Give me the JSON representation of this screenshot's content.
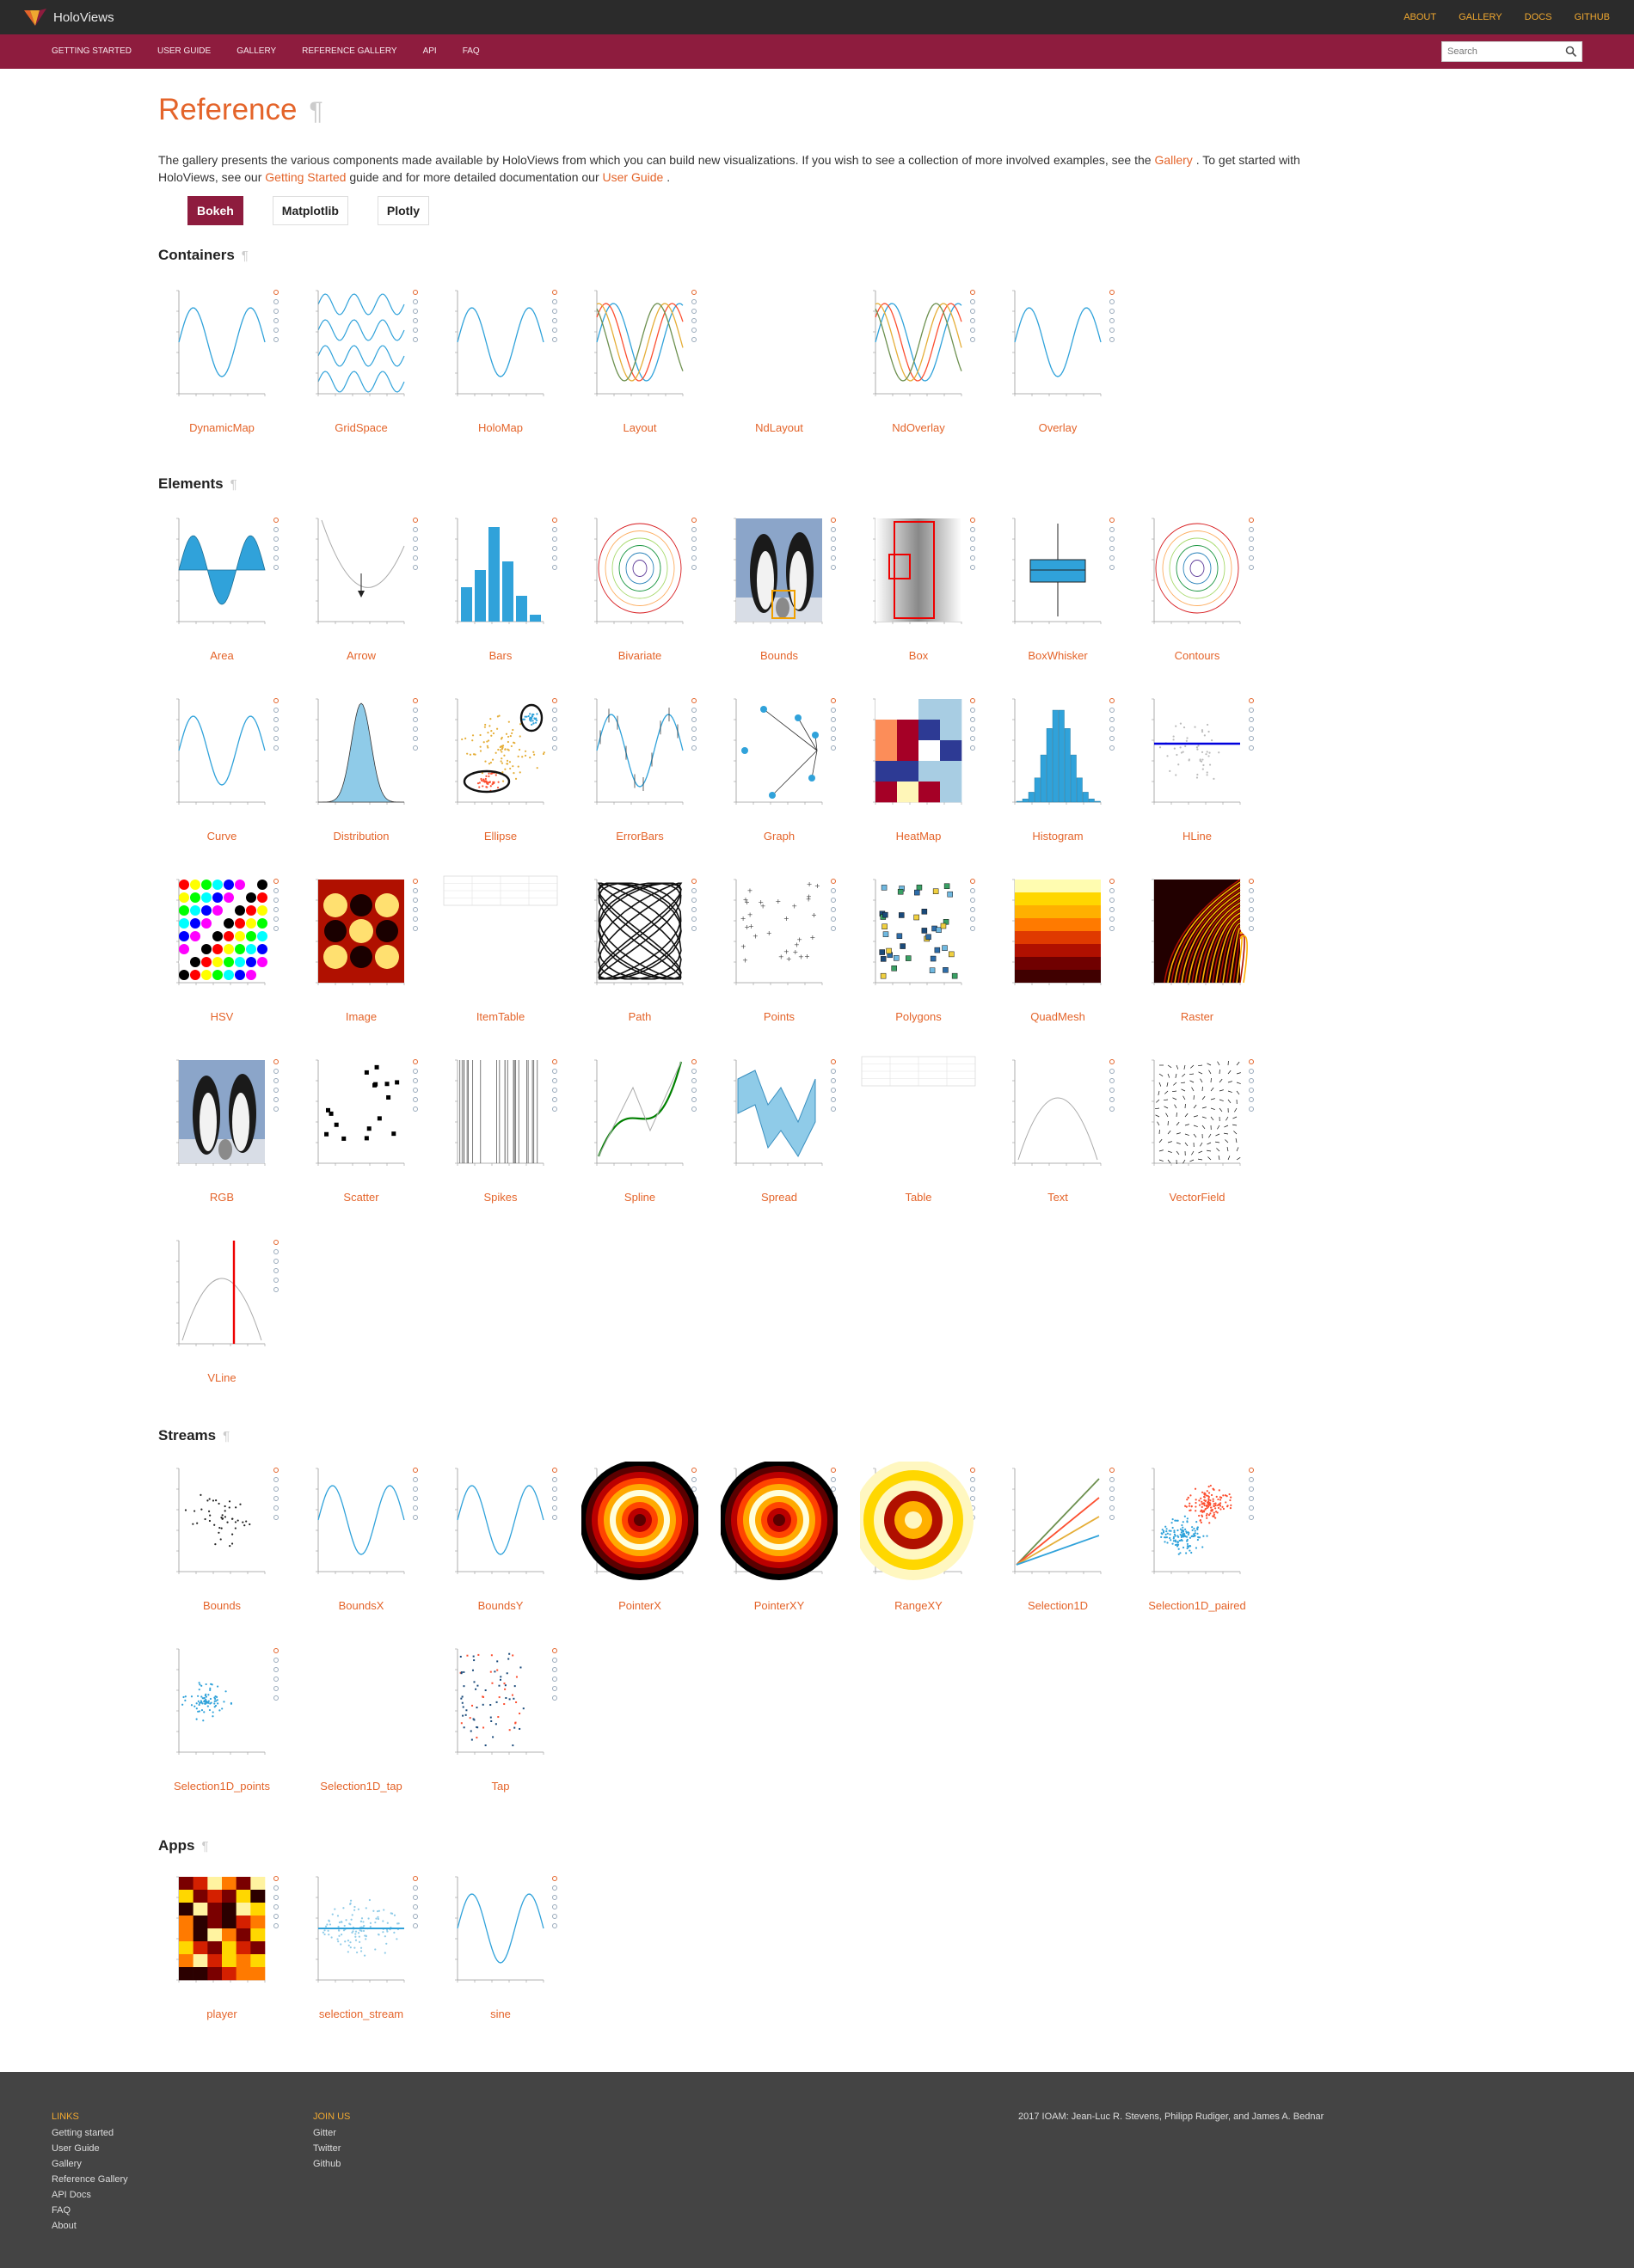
{
  "header": {
    "brand": "HoloViews",
    "links": [
      "ABOUT",
      "GALLERY",
      "DOCS",
      "GITHUB"
    ]
  },
  "nav": {
    "items": [
      "GETTING STARTED",
      "USER GUIDE",
      "GALLERY",
      "REFERENCE GALLERY",
      "API",
      "FAQ"
    ],
    "search_placeholder": "Search"
  },
  "page": {
    "title": "Reference",
    "pilcrow": "¶",
    "intro": {
      "part1": "The gallery presents the various components made available by HoloViews from which you can build new visualizations. If you wish to see a collection of more involved examples, see the",
      "link1": "Gallery",
      "part2": ". To get started with HoloViews, see our",
      "link2": "Getting Started",
      "part3": "guide and for more detailed documentation our",
      "link3": "User Guide",
      "part4": "."
    },
    "backends": [
      "Bokeh",
      "Matplotlib",
      "Plotly"
    ],
    "active_backend": "Bokeh"
  },
  "sections": {
    "containers": {
      "title": "Containers",
      "items": [
        "DynamicMap",
        "GridSpace",
        "HoloMap",
        "Layout",
        "NdLayout",
        "NdOverlay",
        "Overlay"
      ]
    },
    "elements": {
      "title": "Elements",
      "items": [
        "Area",
        "Arrow",
        "Bars",
        "Bivariate",
        "Bounds",
        "Box",
        "BoxWhisker",
        "Contours",
        "Curve",
        "Distribution",
        "Ellipse",
        "ErrorBars",
        "Graph",
        "HeatMap",
        "Histogram",
        "HLine",
        "HSV",
        "Image",
        "ItemTable",
        "Path",
        "Points",
        "Polygons",
        "QuadMesh",
        "Raster",
        "RGB",
        "Scatter",
        "Spikes",
        "Spline",
        "Spread",
        "Table",
        "Text",
        "VectorField",
        "VLine"
      ]
    },
    "streams": {
      "title": "Streams",
      "items": [
        "Bounds",
        "BoundsX",
        "BoundsY",
        "PointerX",
        "PointerXY",
        "RangeXY",
        "Selection1D",
        "Selection1D_paired",
        "Selection1D_points",
        "Selection1D_tap",
        "Tap"
      ]
    },
    "apps": {
      "title": "Apps",
      "items": [
        "player",
        "selection_stream",
        "sine"
      ]
    }
  },
  "footer": {
    "links_title": "LINKS",
    "links": [
      "Getting started",
      "User Guide",
      "Gallery",
      "Reference Gallery",
      "API Docs",
      "FAQ",
      "About"
    ],
    "join_title": "JOIN US",
    "join": [
      "Gitter",
      "Twitter",
      "Github"
    ],
    "copyright": "2017 IOAM: Jean-Luc R. Stevens, Philipp Rudiger, and James A. Bednar"
  },
  "colors": {
    "topbar": "#2b2b2b",
    "navbar": "#8e1c3e",
    "accent": "#e4642a",
    "footer": "#444444",
    "link_gold": "#f0a830"
  }
}
